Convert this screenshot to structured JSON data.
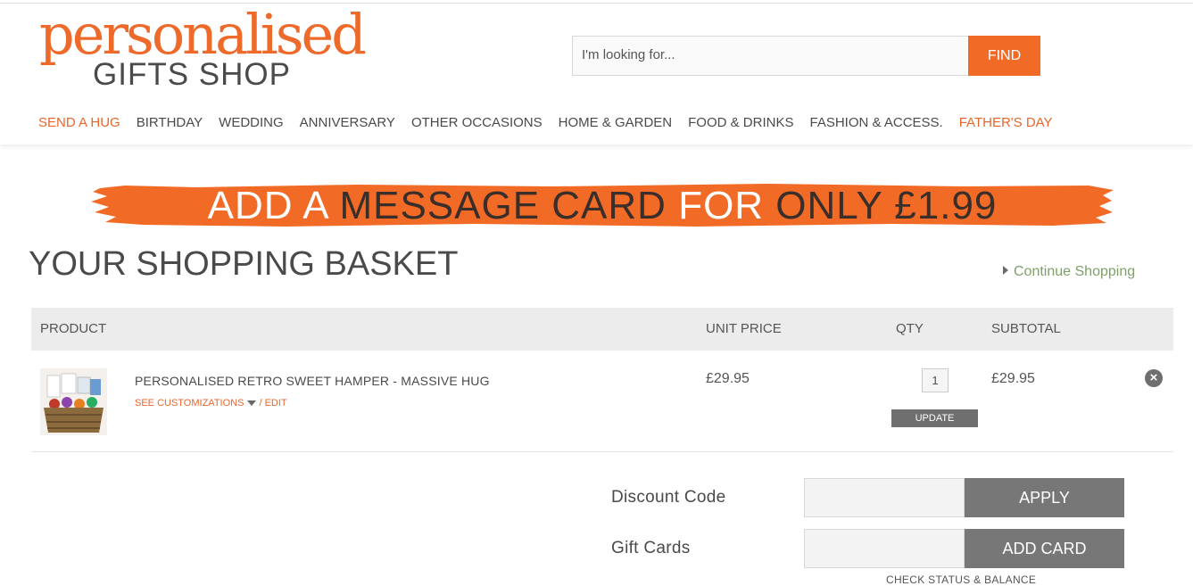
{
  "logo": {
    "top": "personalised",
    "bottom": "GIFTS SHOP"
  },
  "search": {
    "placeholder": "I'm looking for...",
    "button": "FIND"
  },
  "nav": [
    {
      "label": "SEND A HUG",
      "highlight": true
    },
    {
      "label": "BIRTHDAY",
      "highlight": false
    },
    {
      "label": "WEDDING",
      "highlight": false
    },
    {
      "label": "ANNIVERSARY",
      "highlight": false
    },
    {
      "label": "OTHER OCCASIONS",
      "highlight": false
    },
    {
      "label": "HOME & GARDEN",
      "highlight": false
    },
    {
      "label": "FOOD & DRINKS",
      "highlight": false
    },
    {
      "label": "FASHION & ACCESS.",
      "highlight": false
    },
    {
      "label": "FATHER'S DAY",
      "highlight": true
    }
  ],
  "banner": {
    "part1": "ADD A ",
    "part2": "MESSAGE CARD ",
    "part3": "FOR ",
    "part4": "ONLY £1.99"
  },
  "page_title": "YOUR SHOPPING BASKET",
  "continue_shopping": "Continue Shopping",
  "table": {
    "headers": {
      "product": "PRODUCT",
      "unit_price": "UNIT PRICE",
      "qty": "QTY",
      "subtotal": "SUBTOTAL"
    },
    "items": [
      {
        "name": "PERSONALISED RETRO SWEET HAMPER - MASSIVE HUG",
        "see_customizations": "SEE CUSTOMIZATIONS",
        "edit": "/ EDIT",
        "unit_price": "£29.95",
        "qty": "1",
        "update": "UPDATE",
        "subtotal": "£29.95"
      }
    ]
  },
  "discount": {
    "label": "Discount Code",
    "button": "APPLY"
  },
  "gift_cards": {
    "label": "Gift Cards",
    "button": "ADD CARD",
    "check": "CHECK STATUS & BALANCE"
  },
  "colors": {
    "brand_orange": "#f26b26",
    "link_green": "#7fa166",
    "button_grey": "#777777"
  }
}
